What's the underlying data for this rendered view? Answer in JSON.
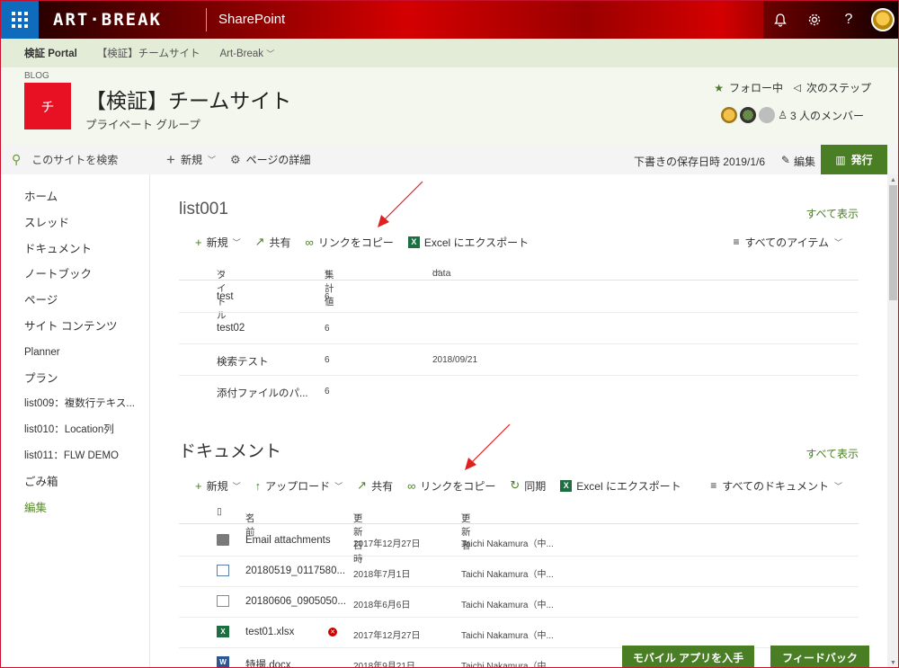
{
  "suitebar": {
    "brand": "ART·BREAK",
    "app_name": "SharePoint",
    "icons": [
      "bell-icon",
      "gear-icon",
      "help-icon",
      "avatar"
    ]
  },
  "breadcrumb": {
    "items": [
      "検証 Portal",
      "【検証】チームサイト",
      "Art-Break"
    ]
  },
  "site": {
    "type_label": "BLOG",
    "logo_letter": "チ",
    "title": "【検証】チームサイト",
    "subtitle": "プライベート グループ",
    "follow_label": "フォロー中",
    "next_step_label": "次のステップ",
    "members_label": "3 人のメンバー"
  },
  "search": {
    "placeholder": "このサイトを検索"
  },
  "nav": {
    "items": [
      "ホーム",
      "スレッド",
      "ドキュメント",
      "ノートブック",
      "ページ",
      "サイト コンテンツ",
      "Planner",
      "プラン",
      "list009：複数行テキス...",
      "list010：Location列",
      "list011：FLW DEMO",
      "ごみ箱",
      "編集"
    ]
  },
  "command": {
    "new_label": "新規",
    "page_details_label": "ページの詳細",
    "draft_saved": "下書きの保存日時 2019/1/6",
    "edit_label": "編集",
    "publish_label": "発行"
  },
  "list_section": {
    "title": "list001",
    "see_all": "すべて表示",
    "toolbar": {
      "new": "新規",
      "share": "共有",
      "copy_link": "リンクをコピー",
      "excel_export": "Excel にエクスポート",
      "view": "すべてのアイテム"
    },
    "columns": [
      "タイトル",
      "集計値",
      "data"
    ],
    "rows": [
      [
        "test",
        "6",
        ""
      ],
      [
        "test02",
        "6",
        ""
      ],
      [
        "検索テスト",
        "6",
        "2018/09/21"
      ],
      [
        "添付ファイルのパ...",
        "6",
        ""
      ]
    ]
  },
  "doc_section": {
    "title": "ドキュメント",
    "see_all": "すべて表示",
    "toolbar": {
      "new": "新規",
      "upload": "アップロード",
      "share": "共有",
      "copy_link": "リンクをコピー",
      "sync": "同期",
      "excel_export": "Excel にエクスポート",
      "view": "すべてのドキュメント"
    },
    "columns": [
      "名前",
      "更新日時",
      "更新者"
    ],
    "rows": [
      {
        "name": "Email attachments",
        "date": "2017年12月27日",
        "by": "Taichi Nakamura（中...",
        "icon": "folder-icon"
      },
      {
        "name": "20180519_0117580...",
        "date": "2018年7月1日",
        "by": "Taichi Nakamura（中...",
        "icon": "video-file-icon"
      },
      {
        "name": "20180606_0905050...",
        "date": "2018年6月6日",
        "by": "Taichi Nakamura（中...",
        "icon": "image-file-icon"
      },
      {
        "name": "test01.xlsx",
        "date": "2017年12月27日",
        "by": "Taichi Nakamura（中...",
        "icon": "excel-file-icon"
      },
      {
        "name": "特撮.docx",
        "date": "2018年9月21日",
        "by": "Taichi Nakamura（中...",
        "icon": "word-file-icon"
      }
    ]
  },
  "floating": {
    "mobile_app": "モバイル アプリを入手",
    "feedback": "フィードバック"
  },
  "colors": {
    "accent_green": "#4a7e25",
    "suitebar_red": "#d40000",
    "logo_red": "#e81123",
    "waffle_blue": "#0f6cbd",
    "annotation_arrow": "#e02020"
  }
}
